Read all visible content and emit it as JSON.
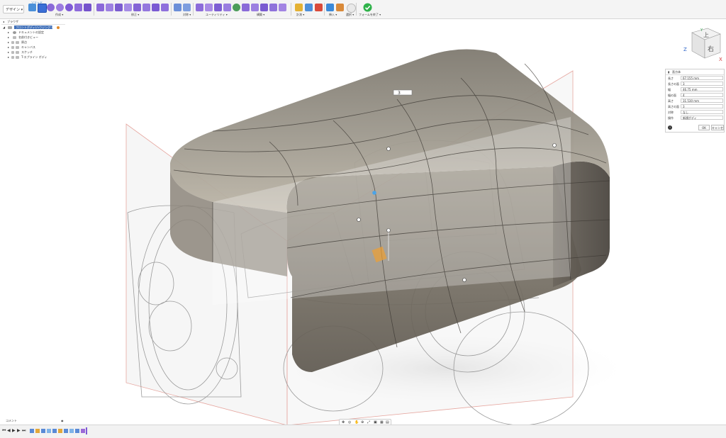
{
  "toolbar": {
    "workspace_label": "デザイン ▾",
    "tab_label": "ソリッド",
    "groups": [
      {
        "label": "作成 ▾"
      },
      {
        "label": "修正 ▾"
      },
      {
        "label": "対称 ▾"
      },
      {
        "label": "ユーティリティ ▾"
      },
      {
        "label": "構築 ▾"
      },
      {
        "label": "計測 ▾"
      },
      {
        "label": "挿入 ▾"
      },
      {
        "label": "選択 ▾"
      },
      {
        "label": "フォームを終了 ▾"
      }
    ],
    "accent_color": "#7f5ad6",
    "finish_color": "#2fb24a"
  },
  "browser": {
    "title": "ブラウザ",
    "root": "フロントボディ/ハウジング:1 (1)",
    "items": [
      {
        "label": "ドキュメントの設定"
      },
      {
        "label": "名前付きビュー"
      },
      {
        "label": "原点"
      },
      {
        "label": "キャンバス"
      },
      {
        "label": "スケッチ"
      },
      {
        "label": "T-スプライン ボディ"
      }
    ]
  },
  "properties": {
    "title": "直方体",
    "rows": [
      {
        "label": "長さ",
        "value": "67.155 mm"
      },
      {
        "label": "長さの面",
        "value": "3"
      },
      {
        "label": "幅",
        "value": "46.75 mm"
      },
      {
        "label": "幅の面",
        "value": "4"
      },
      {
        "label": "高さ",
        "value": "31.530 mm"
      },
      {
        "label": "高さの面",
        "value": "3"
      },
      {
        "label": "対称",
        "value": "なし"
      },
      {
        "label": "操作",
        "value": "新規ボディ"
      }
    ],
    "ok_label": "OK",
    "cancel_label": "キャンセル"
  },
  "viewcube": {
    "face_label": "右",
    "top_label": "上",
    "axis_x": "X",
    "axis_y": "Y",
    "axis_z": "Z"
  },
  "viewport": {
    "dimension_value": "3"
  },
  "timeline": {
    "comments_label": "コメント"
  }
}
